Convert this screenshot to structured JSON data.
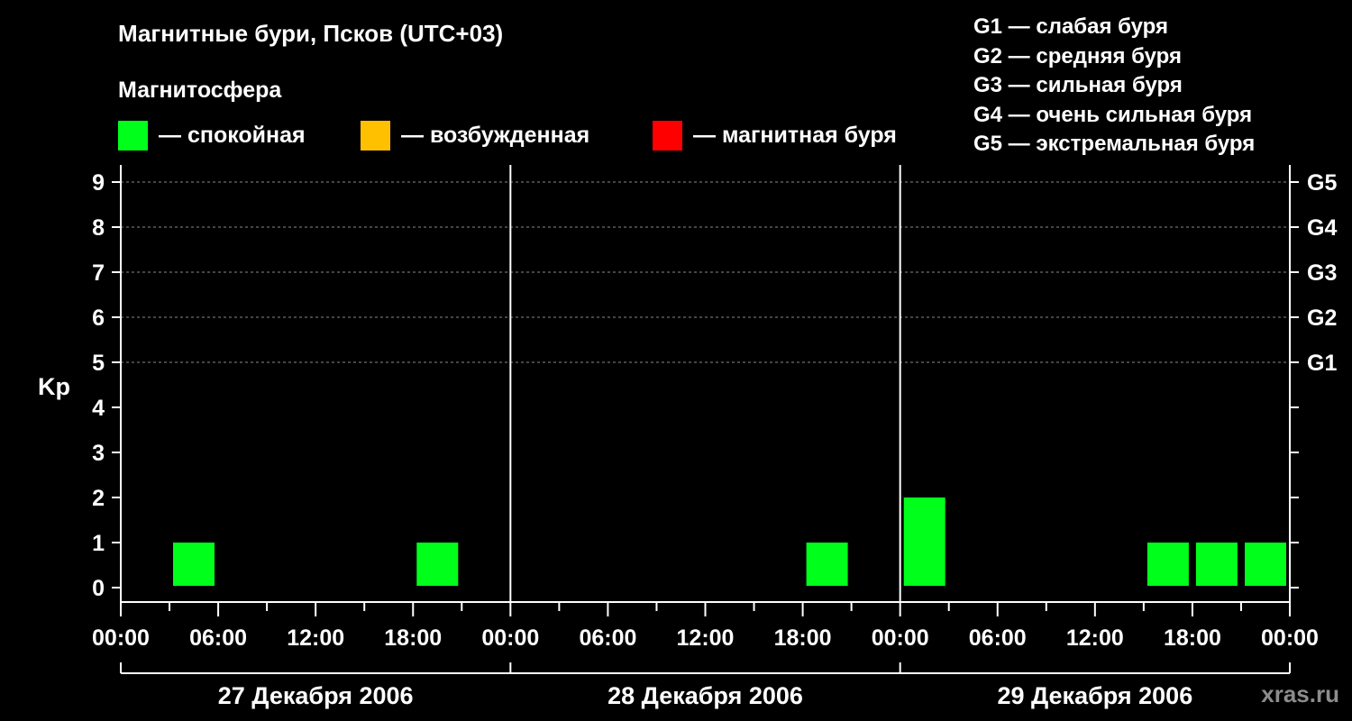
{
  "header": {
    "title": "Магнитные бури, Псков (UTC+03)",
    "subtitle": "Магнитосфера"
  },
  "legend": {
    "items": [
      {
        "label": "— спокойная",
        "color": "#00ff1a"
      },
      {
        "label": "— возбужденная",
        "color": "#ffc000"
      },
      {
        "label": "— магнитная буря",
        "color": "#ff0000"
      }
    ]
  },
  "storm_scale": [
    "G1 — слабая буря",
    "G2 — средняя буря",
    "G3 — сильная буря",
    "G4 — очень сильная буря",
    "G5 — экстремальная буря"
  ],
  "watermark": "xras.ru",
  "chart_data": {
    "type": "bar",
    "ylabel": "Kp",
    "ylim": [
      0,
      9
    ],
    "yticks": [
      "0",
      "1",
      "2",
      "3",
      "4",
      "5",
      "6",
      "7",
      "8",
      "9"
    ],
    "right_ticks": [
      {
        "kp": 5,
        "label": "G1"
      },
      {
        "kp": 6,
        "label": "G2"
      },
      {
        "kp": 7,
        "label": "G3"
      },
      {
        "kp": 8,
        "label": "G4"
      },
      {
        "kp": 9,
        "label": "G5"
      }
    ],
    "xtick_labels": [
      "00:00",
      "06:00",
      "12:00",
      "18:00",
      "00:00",
      "06:00",
      "12:00",
      "18:00",
      "00:00",
      "06:00",
      "12:00",
      "18:00",
      "00:00"
    ],
    "days": [
      "27 Декабря 2006",
      "28 Декабря 2006",
      "29 Декабря 2006"
    ],
    "interval_hours": 3,
    "grid_y": [
      5,
      6,
      7,
      8,
      9
    ],
    "kp_values": [
      [
        0,
        1,
        0,
        0,
        0,
        0,
        1,
        0
      ],
      [
        0,
        0,
        0,
        0,
        0,
        0,
        1,
        0
      ],
      [
        2,
        0,
        0,
        0,
        0,
        1,
        1,
        1
      ]
    ]
  }
}
